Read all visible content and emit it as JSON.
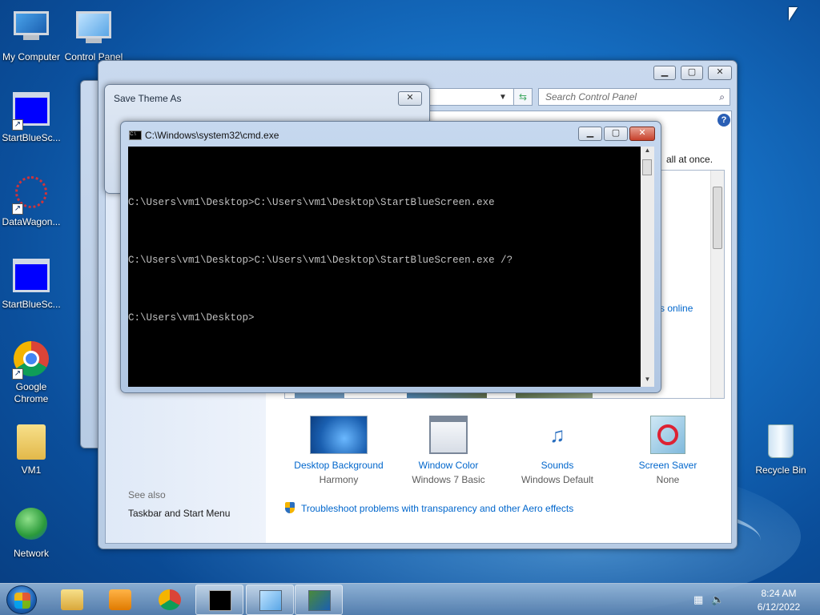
{
  "desktop": {
    "icons": [
      {
        "label": "My Computer"
      },
      {
        "label": "Control Panel"
      },
      {
        "label": "StartBlueSc..."
      },
      {
        "label": "DataWagon..."
      },
      {
        "label": "StartBlueSc..."
      },
      {
        "label": "Google Chrome"
      },
      {
        "label": "VM1"
      },
      {
        "label": "Network"
      },
      {
        "label": "Recycle Bin"
      }
    ]
  },
  "control_panel": {
    "search_placeholder": "Search Control Panel",
    "help_label": "?",
    "partial_text_right": "all at once.",
    "partial_link_online": "s online",
    "see_also": "See also",
    "taskbar_link": "Taskbar and Start Menu",
    "bottom_items": [
      {
        "label": "Desktop Background",
        "sub": "Harmony"
      },
      {
        "label": "Window Color",
        "sub": "Windows 7 Basic"
      },
      {
        "label": "Sounds",
        "sub": "Windows Default"
      },
      {
        "label": "Screen Saver",
        "sub": "None"
      }
    ],
    "troubleshoot_link": "Troubleshoot problems with transparency and other Aero effects"
  },
  "save_theme_dialog": {
    "title": "Save Theme As",
    "close_label": "✕"
  },
  "cmd": {
    "title": "C:\\Windows\\system32\\cmd.exe",
    "lines": [
      "C:\\Users\\vm1\\Desktop>C:\\Users\\vm1\\Desktop\\StartBlueScreen.exe",
      "C:\\Users\\vm1\\Desktop>C:\\Users\\vm1\\Desktop\\StartBlueScreen.exe /?",
      "C:\\Users\\vm1\\Desktop>"
    ],
    "min_label": "▁",
    "max_label": "▢",
    "close_label": "✕"
  },
  "taskbar": {
    "time": "8:24 AM",
    "date": "6/12/2022"
  }
}
